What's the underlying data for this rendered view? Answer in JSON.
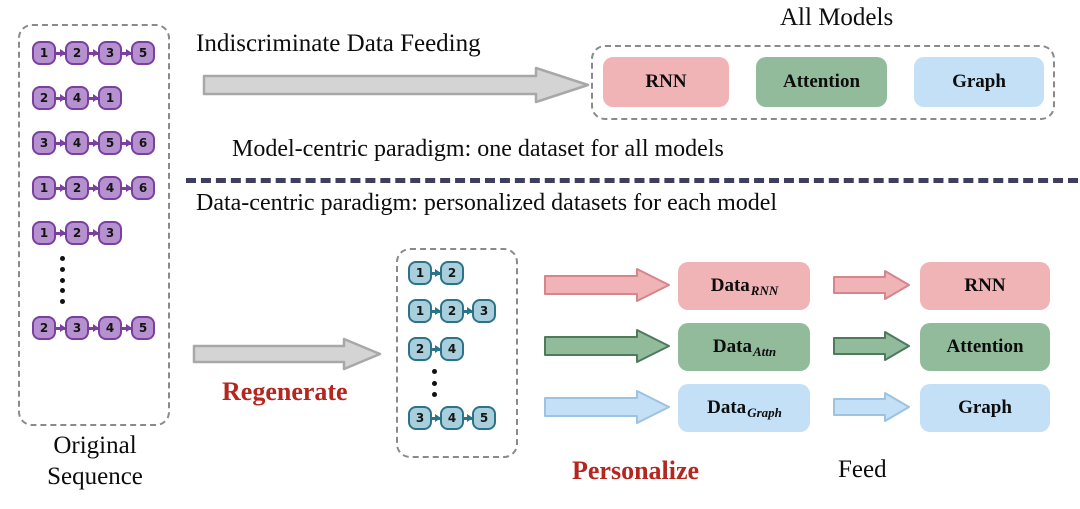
{
  "diagram": {
    "title_all_models": "All Models",
    "top_flow_label": "Indiscriminate Data Feeding",
    "model_centric_caption": "Model-centric paradigm: one dataset for all models",
    "data_centric_caption": "Data-centric paradigm: personalized datasets for each model",
    "regenerate_label": "Regenerate",
    "personalize_label": "Personalize",
    "feed_label": "Feed",
    "original_label_line1": "Original",
    "original_label_line2": "Sequence",
    "ellipsis": "⋮",
    "colors": {
      "purple_fill": "#b691cf",
      "purple_stroke": "#7b3fa0",
      "teal_fill": "#a9cfdd",
      "teal_stroke": "#2b7389",
      "pink": "#f0b4b7",
      "pink_stroke": "#d4868c",
      "green": "#92bb9c",
      "green_stroke": "#4e7a5e",
      "blue": "#c3e0f7",
      "blue_stroke": "#9dc3e0",
      "gray_arrow_fill": "#d4d4d4",
      "gray_arrow_stroke": "#a0a0a0",
      "dashed_border": "#8a8a8a",
      "divider": "#3e3f5e",
      "accent_red": "#b5261e"
    }
  },
  "original_sequences": [
    {
      "nodes": [
        "1",
        "2",
        "3",
        "5"
      ]
    },
    {
      "nodes": [
        "2",
        "4",
        "1"
      ]
    },
    {
      "nodes": [
        "3",
        "4",
        "5",
        "6"
      ]
    },
    {
      "nodes": [
        "1",
        "2",
        "4",
        "6"
      ]
    },
    {
      "nodes": [
        "1",
        "2",
        "3"
      ]
    },
    {
      "nodes": [
        "2",
        "3",
        "4",
        "5"
      ]
    }
  ],
  "regenerated_sequences": [
    {
      "nodes": [
        "1",
        "2"
      ]
    },
    {
      "nodes": [
        "1",
        "2",
        "3"
      ]
    },
    {
      "nodes": [
        "2",
        "4"
      ]
    },
    {
      "nodes": [
        "3",
        "4",
        "5"
      ]
    }
  ],
  "all_models_chips": [
    {
      "label": "RNN",
      "color": "pink"
    },
    {
      "label": "Attention",
      "color": "green"
    },
    {
      "label": "Graph",
      "color": "blue"
    }
  ],
  "personalized_rows": [
    {
      "data_label": "Data",
      "data_sub": "RNN",
      "model_label": "RNN",
      "color": "pink"
    },
    {
      "data_label": "Data",
      "data_sub": "Attn",
      "model_label": "Attention",
      "color": "green"
    },
    {
      "data_label": "Data",
      "data_sub": "Graph",
      "model_label": "Graph",
      "color": "blue"
    }
  ]
}
